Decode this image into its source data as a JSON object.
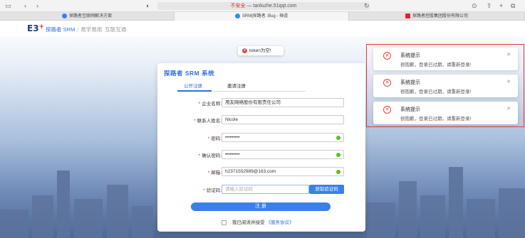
{
  "browser": {
    "address_insecure": "不安全",
    "address_host": "— tanluzhe.51qqt.com",
    "tabs": [
      {
        "label": "探路者互联网解决方案"
      },
      {
        "label": "SRM|探路者 :Bug - 禅道"
      },
      {
        "label": "探路者控股集团股份有限公司"
      }
    ]
  },
  "header": {
    "logo_text": "E3",
    "logo_mark": "+",
    "brand": "探路者 SRM",
    "sub1": "易学易用",
    "sub2": "互联互通"
  },
  "toast": {
    "text": "token为空!"
  },
  "card": {
    "title": "探路者 SRM 系统",
    "tabs": [
      "公开注册",
      "邀请注册"
    ],
    "fields": [
      {
        "label": "企业名称:",
        "value": "用友网络股份有限责任公司"
      },
      {
        "label": "联系人姓名:",
        "value": "Nicole"
      },
      {
        "label": "密码:",
        "value": "•••••••••"
      },
      {
        "label": "确认密码:",
        "value": "•••••••••"
      },
      {
        "label": "邮箱:",
        "value": "h2371552989@163.com"
      },
      {
        "label": "验证码:",
        "placeholder": "请输入验证码"
      }
    ],
    "code_button": "获取验证码",
    "submit": "注 册",
    "agree_text": "我已阅读并接受",
    "agree_link": "《服务协议》"
  },
  "notifications": [
    {
      "title": "系统提示",
      "message": "很抱歉，登录已过期，请重新登录!"
    },
    {
      "title": "系统提示",
      "message": "很抱歉，登录已过期，请重新登录!"
    },
    {
      "title": "系统提示",
      "message": "很抱歉，登录已过期，请重新登录!"
    }
  ]
}
